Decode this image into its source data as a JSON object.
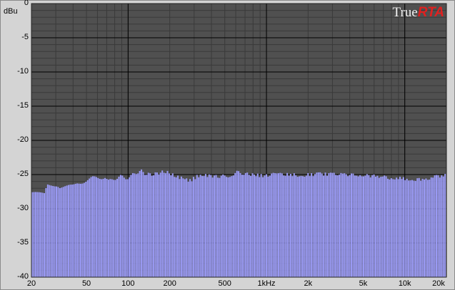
{
  "app": {
    "unit_label": "dBu",
    "logo_true": "True",
    "logo_rta": "RTA"
  },
  "colors": {
    "plot_bg": "#505050",
    "grid_major": "#000000",
    "grid_minor": "#3a3a3a",
    "bar": "#9a9af5",
    "bar_edge": "#7b7be0",
    "logo_accent": "#e0201f"
  },
  "chart_data": {
    "type": "bar",
    "x_scale": "log",
    "xlim": [
      20,
      20000
    ],
    "ylim": [
      -40,
      0
    ],
    "grid": true,
    "x_ticks": [
      {
        "v": 20,
        "label": "20"
      },
      {
        "v": 50,
        "label": "50"
      },
      {
        "v": 100,
        "label": "100"
      },
      {
        "v": 200,
        "label": "200"
      },
      {
        "v": 500,
        "label": "500"
      },
      {
        "v": 1000,
        "label": "1kHz"
      },
      {
        "v": 2000,
        "label": "2k"
      },
      {
        "v": 5000,
        "label": "5k"
      },
      {
        "v": 10000,
        "label": "10k"
      },
      {
        "v": 20000,
        "label": "20k"
      }
    ],
    "y_ticks": [
      {
        "v": 0,
        "label": "0"
      },
      {
        "v": -5,
        "label": "-5"
      },
      {
        "v": -10,
        "label": "-10"
      },
      {
        "v": -15,
        "label": "-15"
      },
      {
        "v": -20,
        "label": "-20"
      },
      {
        "v": -25,
        "label": "-25"
      },
      {
        "v": -30,
        "label": "-30"
      },
      {
        "v": -35,
        "label": "-35"
      },
      {
        "v": -40,
        "label": "-40"
      }
    ],
    "spectrum_level_dbu": [
      {
        "f": 20,
        "v": -27.8
      },
      {
        "f": 25,
        "v": -27.8
      },
      {
        "f": 26,
        "v": -26.4
      },
      {
        "f": 31,
        "v": -26.5
      },
      {
        "f": 32,
        "v": -26.8
      },
      {
        "f": 40,
        "v": -26.7
      },
      {
        "f": 43,
        "v": -26.3
      },
      {
        "f": 48,
        "v": -26.0
      },
      {
        "f": 55,
        "v": -25.5
      },
      {
        "f": 68,
        "v": -25.4
      },
      {
        "f": 72,
        "v": -26.0
      },
      {
        "f": 80,
        "v": -25.6
      },
      {
        "f": 88,
        "v": -25.2
      },
      {
        "f": 95,
        "v": -25.6
      },
      {
        "f": 105,
        "v": -25.2
      },
      {
        "f": 115,
        "v": -24.7
      },
      {
        "f": 125,
        "v": -24.5
      },
      {
        "f": 135,
        "v": -24.9
      },
      {
        "f": 150,
        "v": -25.0
      },
      {
        "f": 170,
        "v": -24.7
      },
      {
        "f": 185,
        "v": -24.6
      },
      {
        "f": 200,
        "v": -24.8
      },
      {
        "f": 220,
        "v": -25.3
      },
      {
        "f": 250,
        "v": -25.5
      },
      {
        "f": 280,
        "v": -25.9
      },
      {
        "f": 320,
        "v": -25.2
      },
      {
        "f": 380,
        "v": -25.1
      },
      {
        "f": 450,
        "v": -25.3
      },
      {
        "f": 520,
        "v": -25.2
      },
      {
        "f": 580,
        "v": -25.0
      },
      {
        "f": 620,
        "v": -24.2
      },
      {
        "f": 680,
        "v": -24.9
      },
      {
        "f": 800,
        "v": -25.0
      },
      {
        "f": 950,
        "v": -25.2
      },
      {
        "f": 1100,
        "v": -25.0
      },
      {
        "f": 1400,
        "v": -25.0
      },
      {
        "f": 1800,
        "v": -25.1
      },
      {
        "f": 2500,
        "v": -24.9
      },
      {
        "f": 3200,
        "v": -25.0
      },
      {
        "f": 4500,
        "v": -25.1
      },
      {
        "f": 6000,
        "v": -25.2
      },
      {
        "f": 8000,
        "v": -25.5
      },
      {
        "f": 10000,
        "v": -25.6
      },
      {
        "f": 12000,
        "v": -25.7
      },
      {
        "f": 14000,
        "v": -25.6
      },
      {
        "f": 17000,
        "v": -25.3
      },
      {
        "f": 20000,
        "v": -25.1
      }
    ]
  }
}
